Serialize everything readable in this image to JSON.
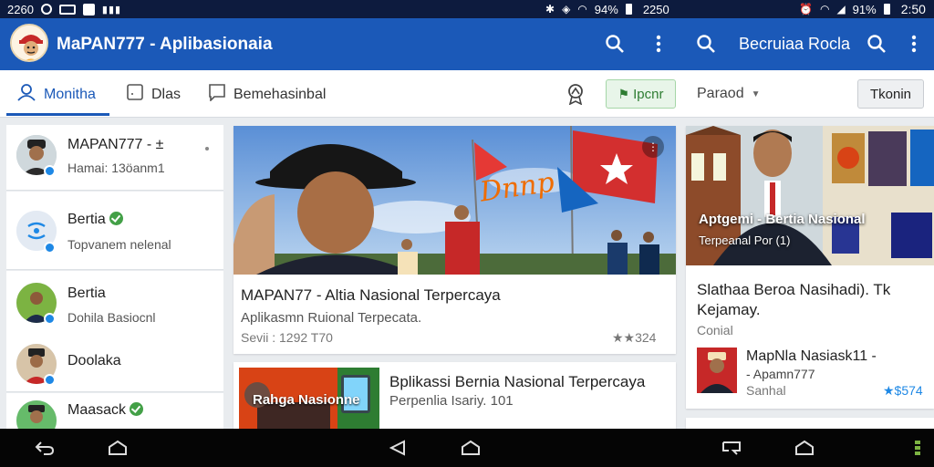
{
  "status_bar": {
    "left_text": "2260",
    "battery_left": "94%",
    "time_left": "2250",
    "battery_right": "91%",
    "time_right": "2:50"
  },
  "app_bar": {
    "title": "MaPAN777 - Aplibasionaia",
    "right_title": "Becruiaa Rocla",
    "icons": [
      "search-icon",
      "more-vert-icon",
      "search-icon",
      "search-icon",
      "more-vert-icon"
    ]
  },
  "tabs": [
    {
      "label": "Monitha",
      "icon": "person-icon",
      "active": true
    },
    {
      "label": "Dlas",
      "icon": "document-icon",
      "active": false
    },
    {
      "label": "Bemehasinbal",
      "icon": "chat-icon",
      "active": false
    }
  ],
  "toolbar": {
    "award_icon": "award-icon",
    "report_label": "Ipcnr",
    "sort_label": "Paraod",
    "button_label": "Tkonin"
  },
  "sidebar": {
    "items": [
      {
        "name": "MAPAN777 - ±",
        "sub": "Hamai: 13öanm1"
      },
      {
        "name": "Bertia",
        "sub": "Topvanem nelenal"
      },
      {
        "name": "Bertia",
        "sub": "Dohila Basiocnl"
      },
      {
        "name": "Doolaka",
        "sub": ""
      },
      {
        "name": "Maasack",
        "sub": ""
      }
    ]
  },
  "feed": {
    "main_card": {
      "image_caption": "Dnnp",
      "title": "MAPAN77 - Altia Nasional Terpercaya",
      "subtitle": "Aplikasmn Ruional Terpecata.",
      "meta": "Sevii : 1292 T70",
      "count": "★★324"
    },
    "second_card": {
      "image_label": "Rahga Nasionne",
      "title": "Bplikassi Bernia Nasional Terpercaya",
      "subtitle": "Perpenlia Isariy.   101"
    },
    "right_card": {
      "image_title": "Aptgemi - Bertia Nasional",
      "image_sub": "Terpeanal Por (1)",
      "title_line1": "Slathaa Beroa Nasihadi). Tk",
      "title_line2": "Kejamay.",
      "label": "Conial",
      "sub_name": "MapNla Nasiask11 -",
      "sub_name2": "- Apamn777",
      "sub_meta": "Sanhal",
      "count": "★$574"
    }
  },
  "colors": {
    "app_bar": "#1b59b8",
    "status_bar": "#0d1b3e",
    "accent": "#1b59b8",
    "verified": "#1e88e5",
    "online": "#43a047",
    "report_bg": "#e8f5e9"
  },
  "nav_bar": [
    "back-icon",
    "recent-apps-icon",
    "back-icon",
    "home-icon",
    "recent-apps-icon",
    "home-icon"
  ]
}
